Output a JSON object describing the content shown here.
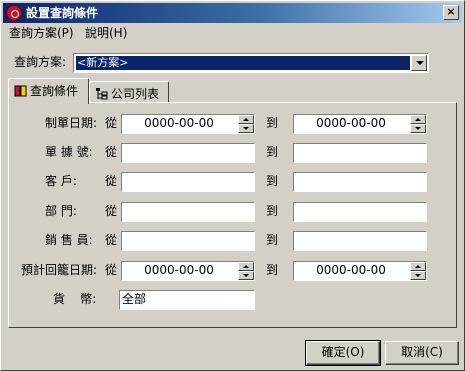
{
  "window": {
    "title": "設置查詢條件",
    "close_glyph": "×"
  },
  "menu": {
    "items": [
      "查詢方案(P)",
      "說明(H)"
    ]
  },
  "scheme": {
    "label": "查詢方案:",
    "selected": "<新方案>"
  },
  "tabs": [
    {
      "label": "查詢條件",
      "icon": "filter-icon",
      "active": true
    },
    {
      "label": "公司列表",
      "icon": "tree-list-icon",
      "active": false
    }
  ],
  "form": {
    "to_label": "到",
    "from_label": "從",
    "rows": [
      {
        "label": "制單日期:",
        "type": "date",
        "from": "0000-00-00",
        "to": "0000-00-00"
      },
      {
        "label": "單 據 號:",
        "type": "text",
        "from": "",
        "to": ""
      },
      {
        "label": "客    戶:",
        "type": "text",
        "from": "",
        "to": ""
      },
      {
        "label": "部    門:",
        "type": "text",
        "from": "",
        "to": ""
      },
      {
        "label": "銷 售 員:",
        "type": "text",
        "from": "",
        "to": ""
      },
      {
        "label": "預計回籠日期:",
        "type": "date",
        "from": "0000-00-00",
        "to": "0000-00-00"
      }
    ],
    "currency": {
      "label": "貨    幣:",
      "value": "全部"
    }
  },
  "buttons": {
    "ok": "確定(O)",
    "cancel": "取消(C)"
  },
  "colors": {
    "title_start": "#0a246a",
    "title_end": "#a6caf0",
    "face": "#d4d0c8",
    "selection": "#0a246a"
  }
}
